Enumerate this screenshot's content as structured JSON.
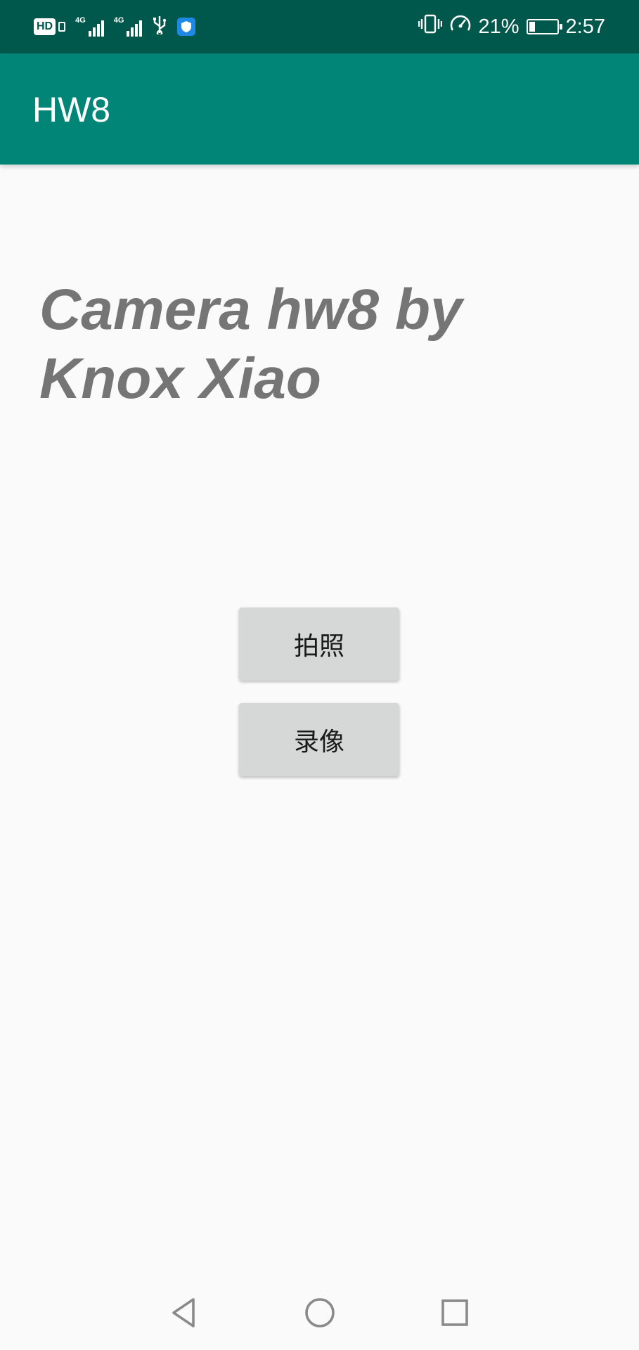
{
  "status_bar": {
    "hd_label": "HD",
    "network_1": "4G",
    "network_2": "4G",
    "battery_percent_text": "21%",
    "battery_level": 0.21,
    "time": "2:57",
    "icons": [
      "hd-icon",
      "signal-icon",
      "usb-icon",
      "shield-icon",
      "vibrate-icon",
      "speed-icon",
      "battery-icon"
    ]
  },
  "app_bar": {
    "title": "HW8"
  },
  "main": {
    "headline": "Camera hw8 by Knox Xiao",
    "photo_button_label": "拍照",
    "video_button_label": "录像"
  },
  "nav_bar": {
    "icons": [
      "back-icon",
      "home-icon",
      "recents-icon"
    ]
  },
  "colors": {
    "status_bar": "#00574b",
    "app_bar": "#008577",
    "background": "#fafafa",
    "headline": "#757575",
    "button": "#d6d7d7"
  }
}
